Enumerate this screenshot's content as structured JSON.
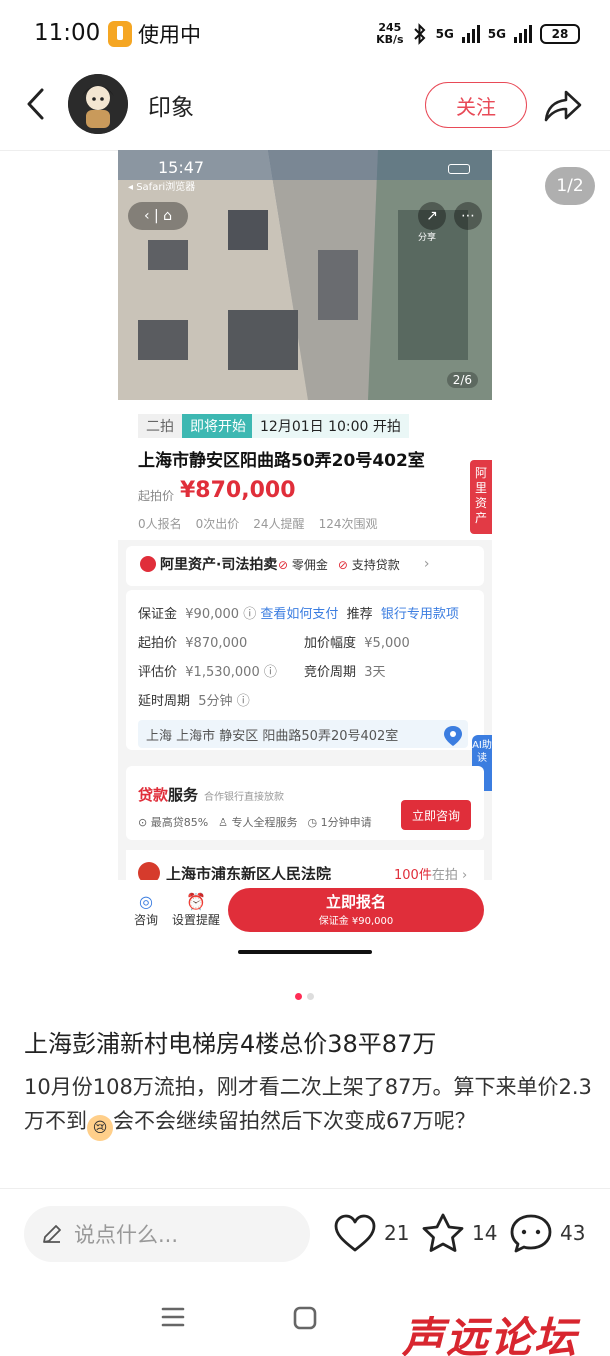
{
  "status_bar": {
    "time": "11:00",
    "in_use": "使用中",
    "net_speed_value": "245",
    "net_speed_unit": "KB/s",
    "network_1": "5G",
    "network_2": "5G",
    "battery": "28"
  },
  "header": {
    "author": "印象",
    "follow_label": "关注"
  },
  "image_counter": "1/2",
  "screenshot": {
    "phone_time": "15:47",
    "browser_label": "◂ Safari浏览器",
    "share_label": "分享",
    "photo_index": "2/6",
    "tag_round": "二拍",
    "tag_status": "即将开始",
    "auction_time": "12月01日 10:00 开拍",
    "property_title": "上海市静安区阳曲路50弄20号402室",
    "start_price_label": "起拍价",
    "start_price": "¥870,000",
    "stats": [
      "0人报名",
      "0次出价",
      "24人提醒",
      "124次围观"
    ],
    "side_tab": "阿里资产",
    "brand": "阿里资产·司法拍卖",
    "brand_features": [
      "零佣金",
      "支持贷款"
    ],
    "deposit_label": "保证金",
    "deposit_value": "¥90,000",
    "deposit_link": "查看如何支付",
    "recommend_label": "推荐",
    "recommend_link": "银行专用款项",
    "start_label": "起拍价",
    "start_value": "¥870,000",
    "increment_label": "加价幅度",
    "increment_value": "¥5,000",
    "appraisal_label": "评估价",
    "appraisal_value": "¥1,530,000",
    "period_label": "竞价周期",
    "period_value": "3天",
    "delay_label": "延时周期",
    "delay_value": "5分钟",
    "location": "上海 上海市 静安区 阳曲路50弄20号402室",
    "ai_tab": "AI助读",
    "loan_title_red": "贷款",
    "loan_title": "服务",
    "loan_sub": "合作银行直接放款",
    "loan_features": [
      "最高贷85%",
      "专人全程服务",
      "1分钟申请"
    ],
    "loan_button": "立即咨询",
    "court_name": "上海市浦东新区人民法院",
    "court_count": "100件",
    "court_count_suffix": "在拍",
    "consult_label": "咨询",
    "remind_label": "设置提醒",
    "signup_label": "立即报名",
    "signup_sub": "保证金 ¥90,000"
  },
  "post": {
    "title": "上海彭浦新村电梯房4楼总价38平87万",
    "body_before": "10月份108万流拍，刚才看二次上架了87万。算下来单价2.3万不到",
    "body_after": "会不会继续留拍然后下次变成67万呢？"
  },
  "actions": {
    "comment_placeholder": "说点什么...",
    "likes": "21",
    "favorites": "14",
    "comments": "43"
  },
  "watermark": "声远论坛",
  "colors": {
    "accent": "#e84a57",
    "price_red": "#e02e3a",
    "link_blue": "#3b7de0",
    "teal": "#3db8b2"
  }
}
